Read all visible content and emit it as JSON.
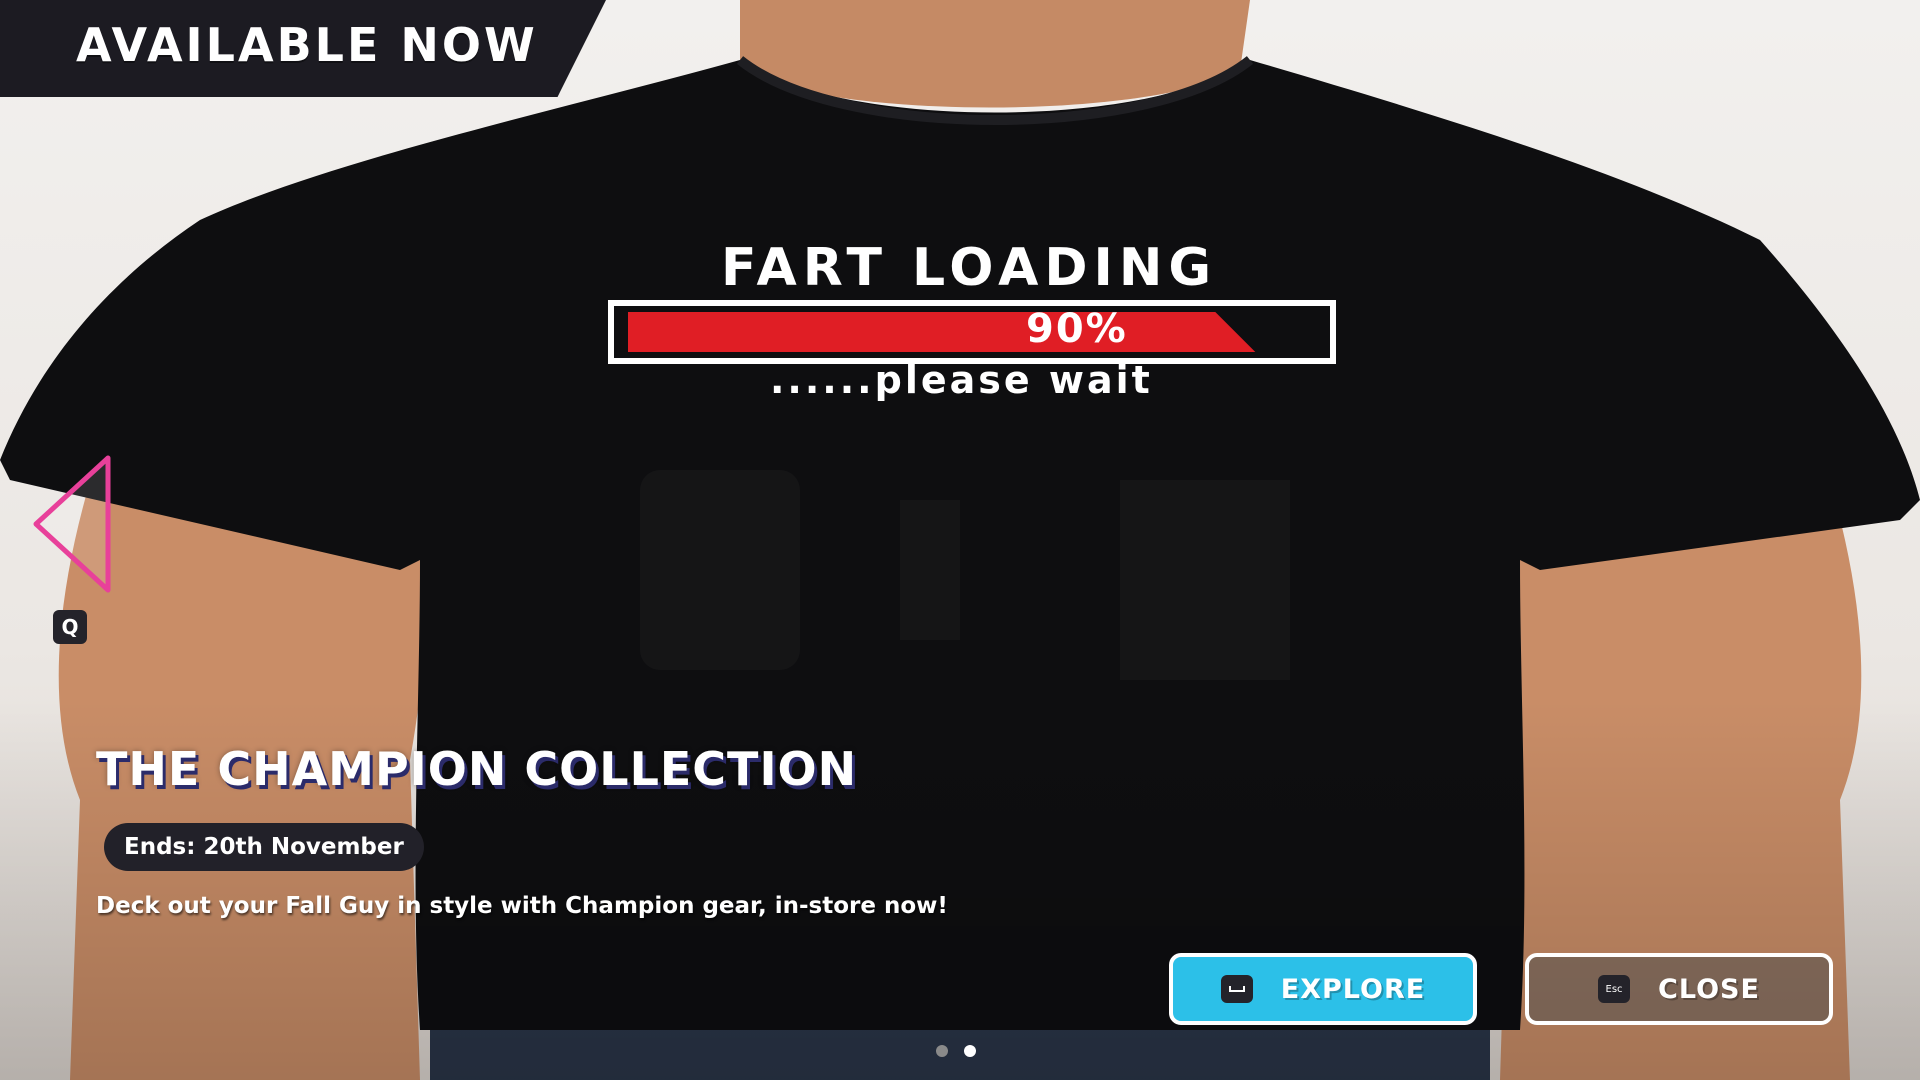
{
  "banner": {
    "text": "AVAILABLE NOW"
  },
  "shirt": {
    "headline": "FART LOADING",
    "progress_label": "90%",
    "progress": 0.9,
    "subtext": "......please wait"
  },
  "nav": {
    "prev_icon": "triangle-left-icon",
    "prev_key": "Q"
  },
  "collection": {
    "title": "THE CHAMPION COLLECTION",
    "ends": "Ends: 20th November",
    "description": "Deck out your Fall Guy in style with Champion gear, in-store now!"
  },
  "buttons": {
    "explore": {
      "label": "EXPLORE",
      "key_icon": "spacebar-icon"
    },
    "close": {
      "label": "CLOSE",
      "key": "Esc"
    }
  },
  "pager": {
    "count": 2,
    "active_index": 1
  },
  "colors": {
    "accent": "#2cc0e8",
    "arrow_outline": "#e8409a",
    "progress_red": "#e01e25",
    "banner_bg": "#1c1b22"
  }
}
